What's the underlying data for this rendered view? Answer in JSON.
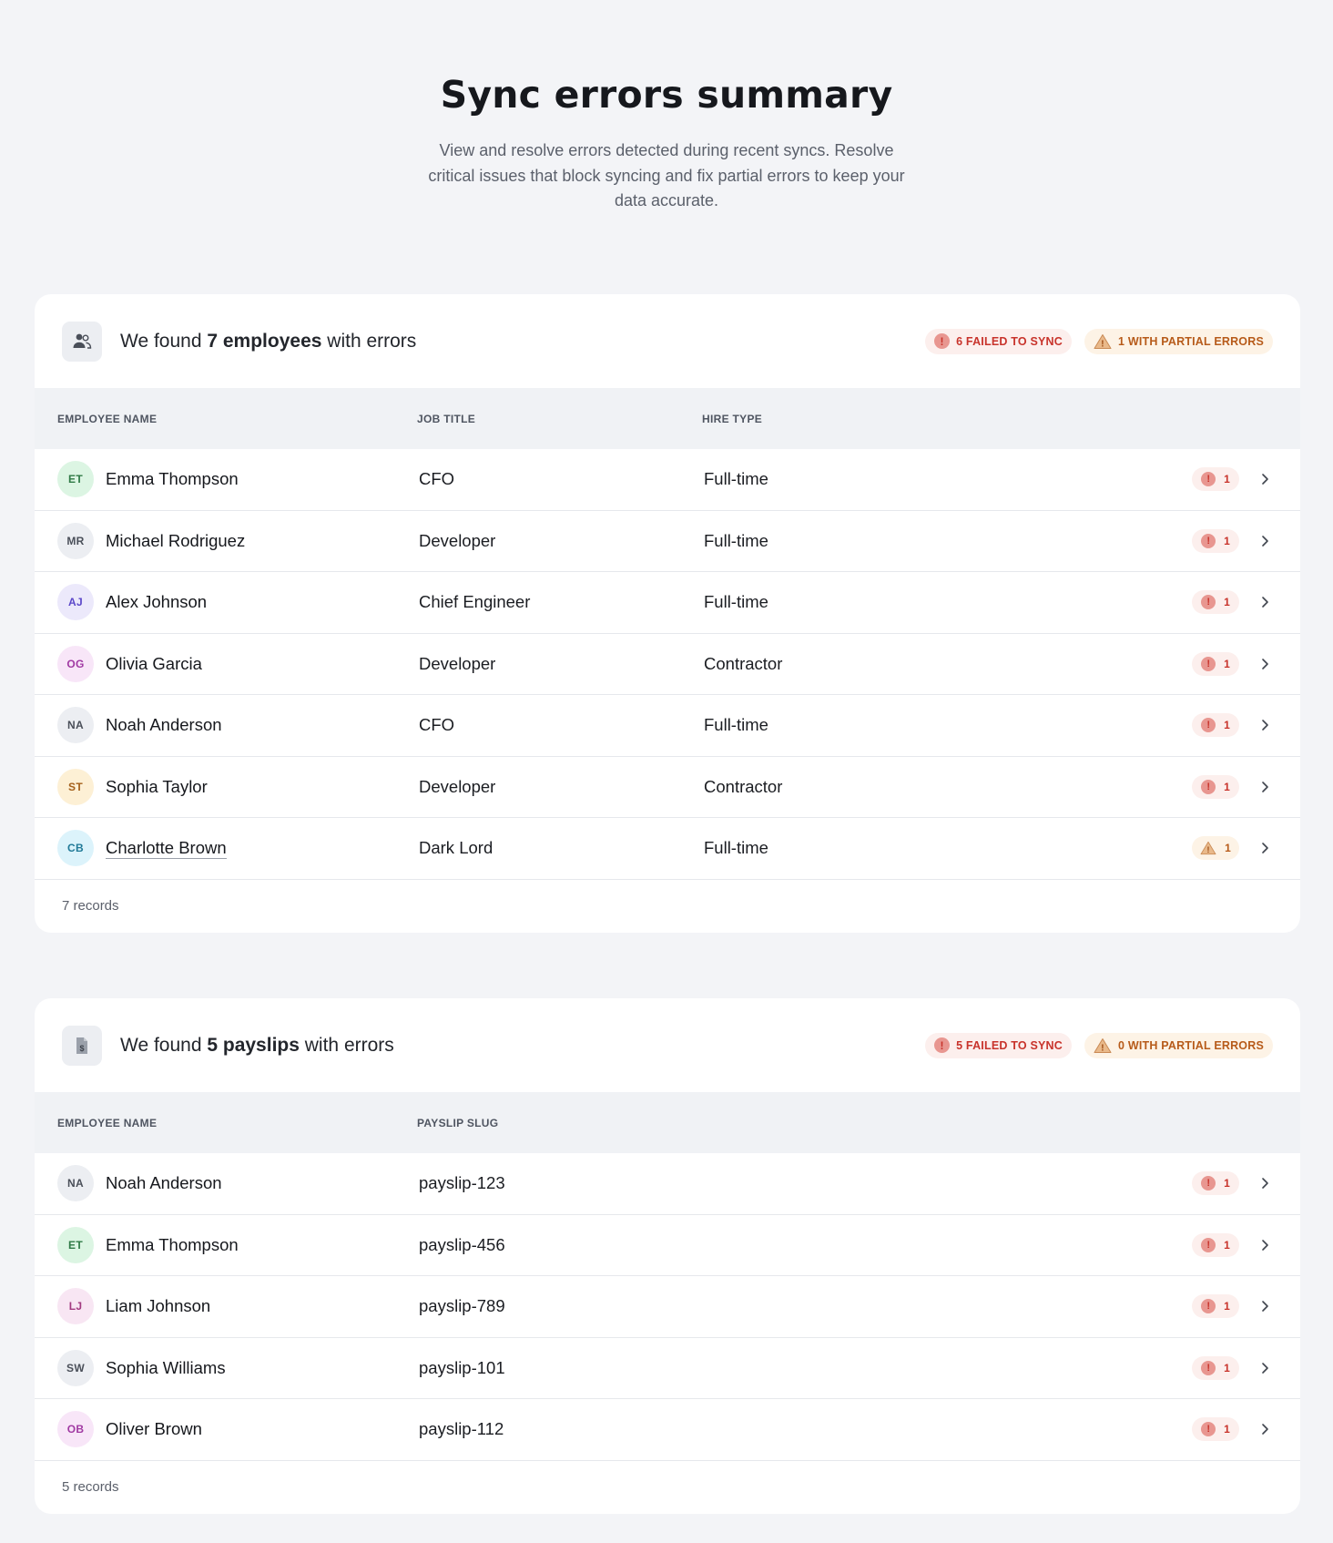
{
  "page": {
    "title": "Sync errors summary",
    "subtitle": "View and resolve errors detected during recent syncs. Resolve critical issues that block syncing and fix partial errors to keep your data accurate."
  },
  "colors": {
    "failed": "#c8332b",
    "partial": "#b75b1a",
    "background": "#f3f4f7"
  },
  "employees_card": {
    "icon": "people-icon",
    "title_prefix": "We found",
    "title_count": "7 employees",
    "title_suffix": "with errors",
    "failed_badge": "6 FAILED TO SYNC",
    "partial_badge": "1 WITH PARTIAL ERRORS",
    "columns": [
      "EMPLOYEE NAME",
      "JOB TITLE",
      "HIRE TYPE"
    ],
    "rows": [
      {
        "initials": "ET",
        "name": "Emma Thompson",
        "job": "CFO",
        "hire": "Full-time",
        "status": "failed",
        "count": "1"
      },
      {
        "initials": "MR",
        "name": "Michael Rodriguez",
        "job": "Developer",
        "hire": "Full-time",
        "status": "failed",
        "count": "1"
      },
      {
        "initials": "AJ",
        "name": "Alex Johnson",
        "job": "Chief Engineer",
        "hire": "Full-time",
        "status": "failed",
        "count": "1"
      },
      {
        "initials": "OG",
        "name": "Olivia Garcia",
        "job": "Developer",
        "hire": "Contractor",
        "status": "failed",
        "count": "1"
      },
      {
        "initials": "NA",
        "name": "Noah Anderson",
        "job": "CFO",
        "hire": "Full-time",
        "status": "failed",
        "count": "1"
      },
      {
        "initials": "ST",
        "name": "Sophia Taylor",
        "job": "Developer",
        "hire": "Contractor",
        "status": "failed",
        "count": "1"
      },
      {
        "initials": "CB",
        "name": "Charlotte Brown",
        "job": "Dark Lord",
        "hire": "Full-time",
        "status": "partial",
        "count": "1"
      }
    ],
    "footer": "7 records"
  },
  "payslips_card": {
    "icon": "payslip-document-icon",
    "title_prefix": "We found",
    "title_count": "5 payslips",
    "title_suffix": "with errors",
    "failed_badge": "5 FAILED TO SYNC",
    "partial_badge": "0 WITH PARTIAL ERRORS",
    "columns": [
      "EMPLOYEE NAME",
      "PAYSLIP SLUG"
    ],
    "rows": [
      {
        "initials": "NA",
        "name": "Noah Anderson",
        "slug": "payslip-123",
        "status": "failed",
        "count": "1"
      },
      {
        "initials": "ET",
        "name": "Emma Thompson",
        "slug": "payslip-456",
        "status": "failed",
        "count": "1"
      },
      {
        "initials": "LJ",
        "name": "Liam Johnson",
        "slug": "payslip-789",
        "status": "failed",
        "count": "1"
      },
      {
        "initials": "SW",
        "name": "Sophia Williams",
        "slug": "payslip-101",
        "status": "failed",
        "count": "1"
      },
      {
        "initials": "OB",
        "name": "Oliver Brown",
        "slug": "payslip-112",
        "status": "failed",
        "count": "1"
      }
    ],
    "footer": "5 records"
  }
}
